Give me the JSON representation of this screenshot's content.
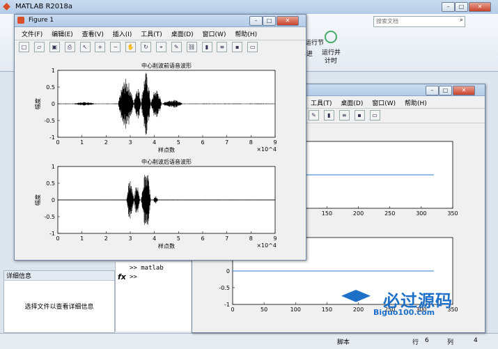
{
  "matlab": {
    "title": "MATLAB R2018a",
    "search_placeholder": "搜索文档",
    "toolstrip": {
      "run_section": "运行节",
      "advance": "进",
      "run_time": "运行并",
      "run_time2": "计时"
    },
    "details": {
      "title": "详细信息",
      "empty": "选择文件以查看详细信息"
    },
    "command": {
      "line1": ">> matlab",
      "prompt": ">>"
    },
    "status": {
      "script": "脚本",
      "row_label": "行",
      "row": "6",
      "col_label": "列",
      "col": "4"
    },
    "colors": {
      "accent": "#1e6fc8",
      "plot_line": "#2a7bd4"
    }
  },
  "figure1": {
    "title": "Figure 1",
    "menus": [
      "文件(F)",
      "编辑(E)",
      "查看(V)",
      "插入(I)",
      "工具(T)",
      "桌面(D)",
      "窗口(W)",
      "帮助(H)"
    ],
    "icons": [
      "new-file-icon",
      "open-icon",
      "save-icon",
      "print-icon",
      "pointer-icon",
      "zoom-in-icon",
      "zoom-out-icon",
      "pan-icon",
      "rotate-icon",
      "data-cursor-icon",
      "brush-icon",
      "link-icon",
      "colorbar-icon",
      "legend-icon",
      "hide-tools-icon",
      "dock-icon"
    ]
  },
  "figure2": {
    "menus": [
      "工具(T)",
      "桌面(D)",
      "窗口(W)",
      "帮助(H)"
    ]
  },
  "watermark": {
    "text": "必过源码",
    "site": "Biguo100.com"
  },
  "chart_data": [
    {
      "type": "line",
      "title": "中心削波前语音波形",
      "xlabel": "样点数",
      "ylabel": "幅度",
      "xlim": [
        0,
        9
      ],
      "ylim": [
        -1,
        1
      ],
      "xticks": [
        "0",
        "1",
        "2",
        "3",
        "4",
        "5",
        "6",
        "7",
        "8",
        "9"
      ],
      "yticks": [
        "1",
        "0.5",
        "0",
        "-0.5",
        "-1"
      ],
      "xexponent": "×10^4"
    },
    {
      "type": "line",
      "title": "中心削波后语音波形",
      "xlabel": "样点数",
      "ylabel": "幅度",
      "xlim": [
        0,
        9
      ],
      "ylim": [
        -1,
        1
      ],
      "xticks": [
        "0",
        "1",
        "2",
        "3",
        "4",
        "5",
        "6",
        "7",
        "8",
        "9"
      ],
      "yticks": [
        "1",
        "0.5",
        "0",
        "-0.5",
        "-1"
      ],
      "xexponent": "×10^4"
    },
    {
      "type": "line",
      "xlim": [
        0,
        350
      ],
      "ylim": [
        -1,
        1
      ],
      "xticks": [
        "150",
        "200",
        "250",
        "300",
        "350"
      ],
      "series": [
        {
          "x": [
            0,
            320
          ],
          "values": [
            0,
            0
          ]
        }
      ]
    },
    {
      "type": "line",
      "xlim": [
        0,
        350
      ],
      "ylim": [
        -1,
        1
      ],
      "xticks": [
        "0",
        "50",
        "100",
        "150",
        "200",
        "250",
        "300",
        "350"
      ],
      "yticks": [
        "0",
        "-0.5",
        "-1"
      ],
      "series": [
        {
          "x": [
            0,
            320
          ],
          "values": [
            0,
            0
          ]
        }
      ]
    }
  ]
}
